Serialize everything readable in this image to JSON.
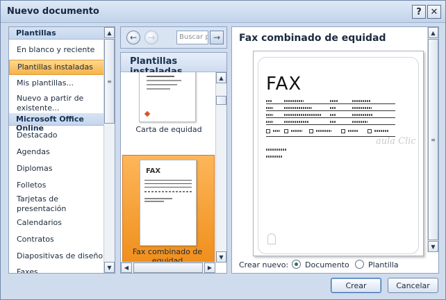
{
  "window": {
    "title": "Nuevo documento",
    "help_label": "?",
    "close_label": "✕"
  },
  "sidebar": {
    "categories": [
      {
        "label": "Plantillas"
      },
      {
        "label": "Microsoft Office Online"
      }
    ],
    "items": [
      {
        "label": "En blanco y reciente"
      },
      {
        "label": "Plantillas instaladas",
        "selected": true
      },
      {
        "label": "Mis plantillas..."
      },
      {
        "label": "Nuevo a partir de existente..."
      },
      {
        "label": "Destacado"
      },
      {
        "label": "Agendas"
      },
      {
        "label": "Diplomas"
      },
      {
        "label": "Folletos"
      },
      {
        "label": "Tarjetas de presentación"
      },
      {
        "label": "Calendarios"
      },
      {
        "label": "Contratos"
      },
      {
        "label": "Diapositivas de diseño"
      },
      {
        "label": "Faxes"
      }
    ]
  },
  "nav": {
    "back_icon": "arrow-left-icon",
    "forward_icon": "arrow-right-icon",
    "search_placeholder": "Buscar p",
    "go_icon": "arrow-right-icon"
  },
  "middle": {
    "header": "Plantillas instaladas",
    "templates": [
      {
        "label": "Carta de equidad"
      },
      {
        "label": "Fax combinado de equidad",
        "selected": true
      }
    ]
  },
  "preview": {
    "title": "Fax combinado de equidad",
    "doc_heading": "FAX",
    "watermark": "aula Clic"
  },
  "create_new": {
    "label": "Crear nuevo:",
    "options": [
      {
        "label": "Documento",
        "selected": true
      },
      {
        "label": "Plantilla",
        "selected": false
      }
    ]
  },
  "buttons": {
    "create": "Crear",
    "cancel": "Cancelar"
  },
  "colors": {
    "selection_orange": "#f5b24d",
    "header_blue": "#cfdcef",
    "window_blue": "#cfdcee"
  }
}
